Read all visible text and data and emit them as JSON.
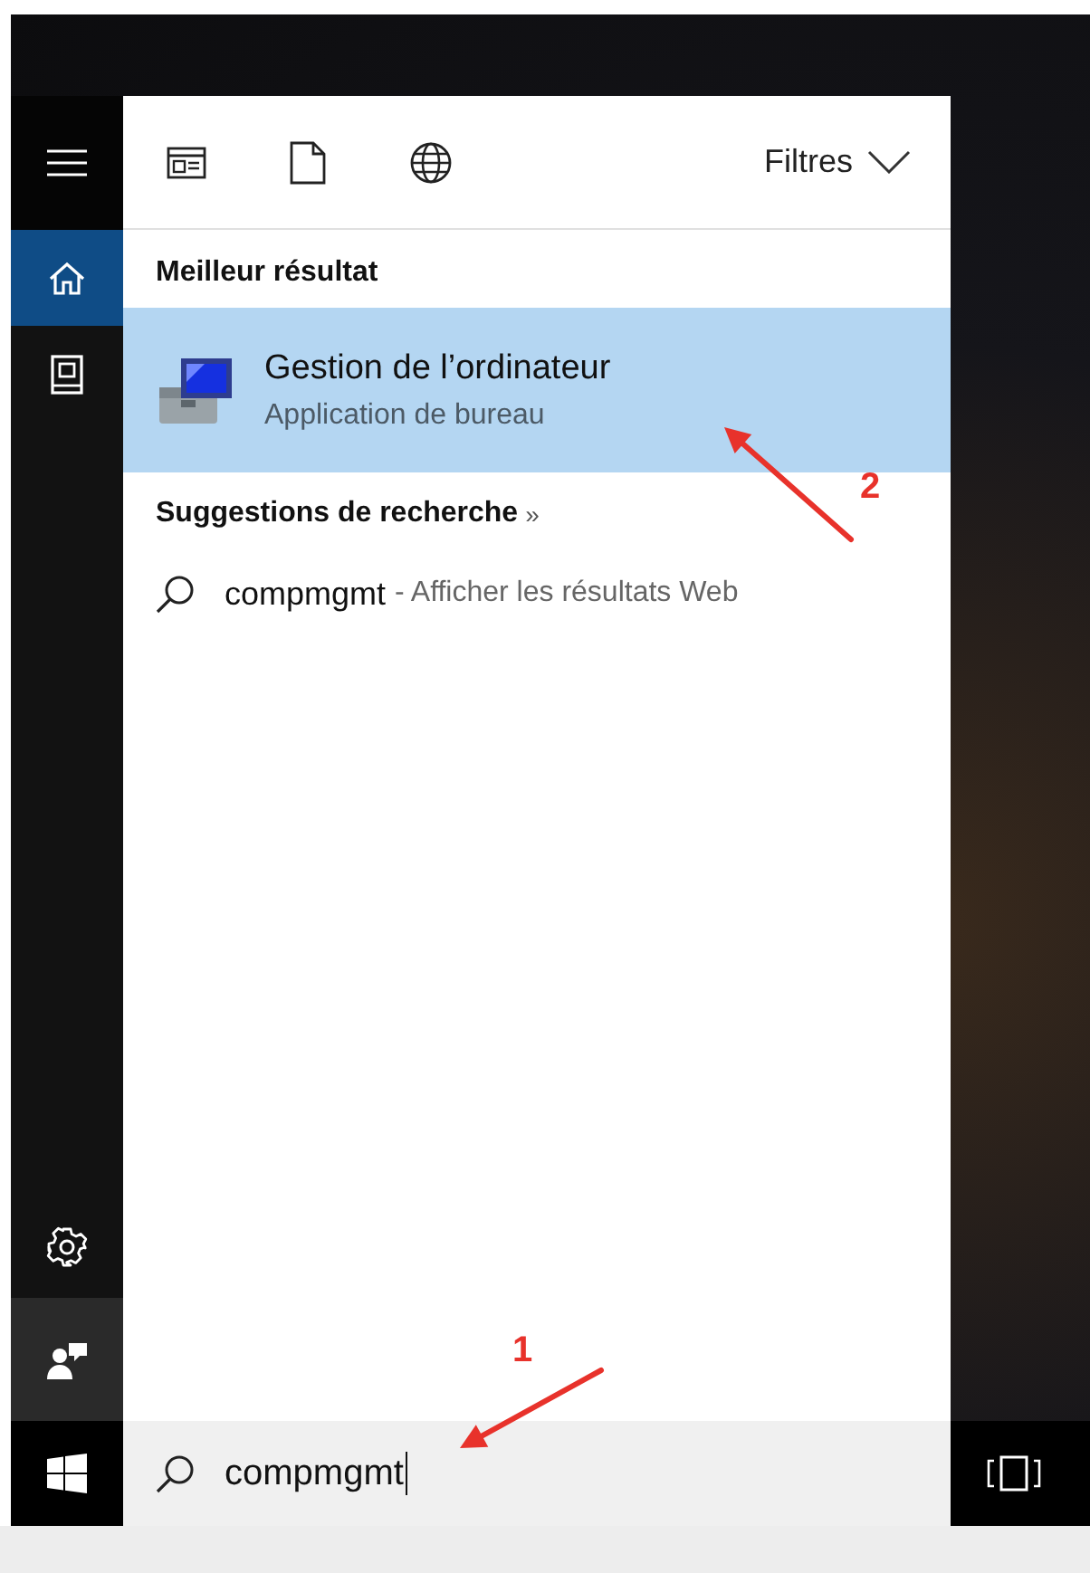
{
  "sidebar": {
    "menu_button": {
      "kind": "menu"
    },
    "nav_items": [
      {
        "kind": "home",
        "selected": true
      },
      {
        "kind": "notebook",
        "selected": false
      }
    ],
    "bottom_items": [
      {
        "kind": "settings"
      },
      {
        "kind": "feedback"
      }
    ]
  },
  "toolbar": {
    "filters": [
      {
        "kind": "apps"
      },
      {
        "kind": "documents"
      },
      {
        "kind": "web"
      }
    ],
    "filter_menu": "Filtres"
  },
  "best_match": {
    "heading": "Meilleur résultat",
    "result": {
      "title": "Gestion de l’ordinateur",
      "subtitle": "Application de bureau",
      "selected": true
    }
  },
  "suggestions": {
    "heading": "Suggestions de recherche",
    "more": "»",
    "items": [
      {
        "query": "compmgmt",
        "detail": "- Afficher les résultats Web"
      }
    ]
  },
  "search": {
    "value": "compmgmt"
  },
  "annotations": [
    {
      "label": "2"
    },
    {
      "label": "1"
    }
  ]
}
